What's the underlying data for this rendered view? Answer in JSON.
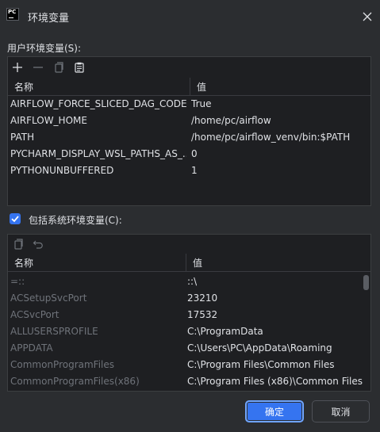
{
  "window": {
    "title": "环境变量"
  },
  "user_section": {
    "label": "用户环境变量(S):",
    "columns": {
      "name": "名称",
      "value": "值"
    },
    "rows": [
      {
        "name": "AIRFLOW_FORCE_SLICED_DAG_CODE",
        "value": "True"
      },
      {
        "name": "AIRFLOW_HOME",
        "value": "/home/pc/airflow"
      },
      {
        "name": "PATH",
        "value": "/home/pc/airflow_venv/bin:$PATH"
      },
      {
        "name": "PYCHARM_DISPLAY_WSL_PATHS_AS_...",
        "value": "0"
      },
      {
        "name": "PYTHONUNBUFFERED",
        "value": "1"
      }
    ]
  },
  "system_section": {
    "checkbox_label": "包括系统环境变量(C):",
    "checked": true,
    "columns": {
      "name": "名称",
      "value": "值"
    },
    "rows": [
      {
        "name": "=::",
        "value": "::\\"
      },
      {
        "name": "ACSetupSvcPort",
        "value": "23210"
      },
      {
        "name": "ACSvcPort",
        "value": "17532"
      },
      {
        "name": "ALLUSERSPROFILE",
        "value": "C:\\ProgramData"
      },
      {
        "name": "APPDATA",
        "value": "C:\\Users\\PC\\AppData\\Roaming"
      },
      {
        "name": "CommonProgramFiles",
        "value": "C:\\Program Files\\Common Files"
      },
      {
        "name": "CommonProgramFiles(x86)",
        "value": "C:\\Program Files (x86)\\Common Files"
      }
    ]
  },
  "buttons": {
    "ok": "确定",
    "cancel": "取消"
  },
  "colors": {
    "accent": "#3574f0",
    "background": "#2b2d30",
    "panel": "#1e1f22",
    "dim_text": "#6f737a"
  },
  "icons": {
    "app": "pycharm-icon",
    "close": "close-icon",
    "add": "plus-icon",
    "remove": "minus-icon",
    "copy": "copy-icon",
    "paste": "paste-icon",
    "undo": "undo-icon",
    "check": "checkmark-icon"
  }
}
